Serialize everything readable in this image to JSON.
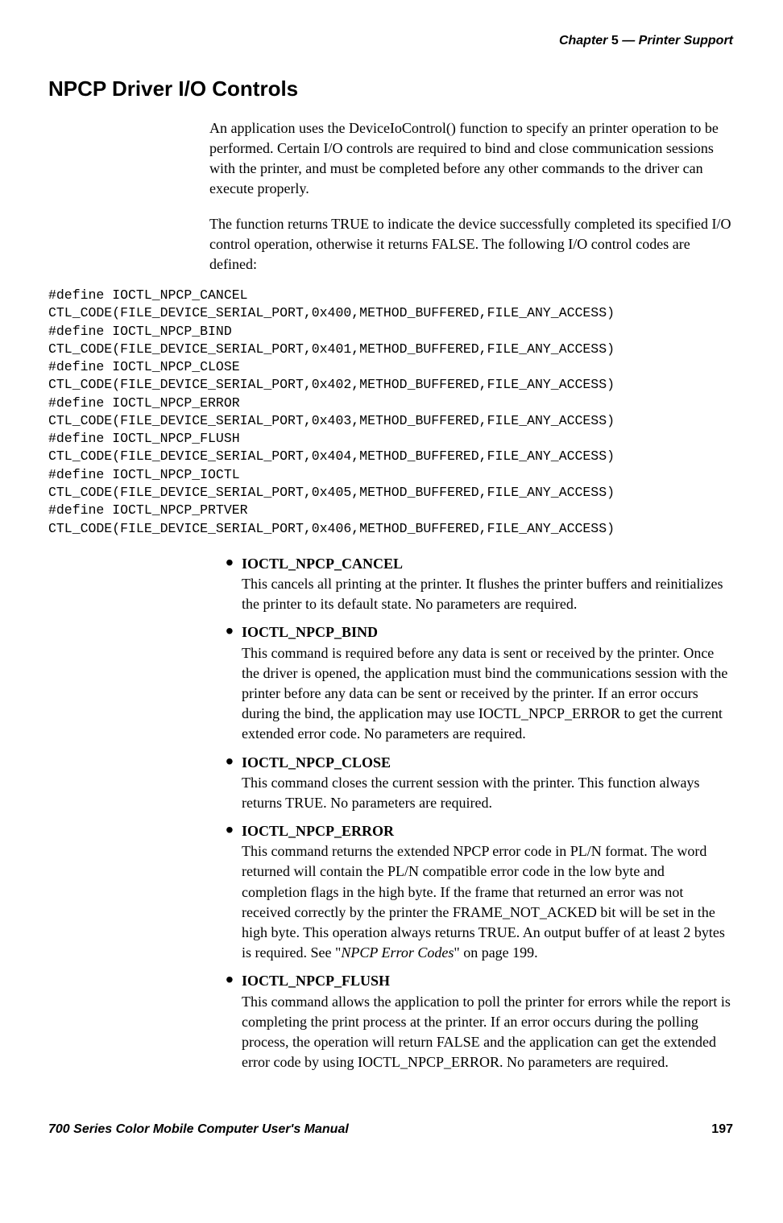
{
  "header": {
    "chapter_label": "Chapter",
    "chapter_num": "5",
    "separator": "—",
    "chapter_title": "Printer Support"
  },
  "title": "NPCP Driver I/O Controls",
  "para1": "An application uses the DeviceIoControl() function to specify an printer operation to be performed. Certain I/O controls are required to bind and close communication sessions with the printer, and must be completed before any other commands to the driver can execute properly.",
  "para2": "The function returns TRUE to indicate the device successfully completed its specified I/O control operation, otherwise it returns FALSE. The following I/O control codes are defined:",
  "code": "#define IOCTL_NPCP_CANCEL\nCTL_CODE(FILE_DEVICE_SERIAL_PORT,0x400,METHOD_BUFFERED,FILE_ANY_ACCESS)\n#define IOCTL_NPCP_BIND\nCTL_CODE(FILE_DEVICE_SERIAL_PORT,0x401,METHOD_BUFFERED,FILE_ANY_ACCESS)\n#define IOCTL_NPCP_CLOSE\nCTL_CODE(FILE_DEVICE_SERIAL_PORT,0x402,METHOD_BUFFERED,FILE_ANY_ACCESS)\n#define IOCTL_NPCP_ERROR\nCTL_CODE(FILE_DEVICE_SERIAL_PORT,0x403,METHOD_BUFFERED,FILE_ANY_ACCESS)\n#define IOCTL_NPCP_FLUSH\nCTL_CODE(FILE_DEVICE_SERIAL_PORT,0x404,METHOD_BUFFERED,FILE_ANY_ACCESS)\n#define IOCTL_NPCP_IOCTL\nCTL_CODE(FILE_DEVICE_SERIAL_PORT,0x405,METHOD_BUFFERED,FILE_ANY_ACCESS)\n#define IOCTL_NPCP_PRTVER\nCTL_CODE(FILE_DEVICE_SERIAL_PORT,0x406,METHOD_BUFFERED,FILE_ANY_ACCESS)",
  "items": [
    {
      "title": "IOCTL_NPCP_CANCEL",
      "desc": "This cancels all printing at the printer. It flushes the printer buffers and reinitializes the printer to its default state. No parameters are required."
    },
    {
      "title": "IOCTL_NPCP_BIND",
      "desc": "This command is required before any data is sent or received by the printer. Once the driver is opened, the application must bind the communications session with the printer before any data can be sent or received by the printer. If an error occurs during the bind, the application may use IOCTL_NPCP_ERROR to get the current extended error code. No parameters are required."
    },
    {
      "title": "IOCTL_NPCP_CLOSE",
      "desc": "This command closes the current session with the printer. This function always returns TRUE. No parameters are required."
    },
    {
      "title": "IOCTL_NPCP_ERROR",
      "desc_pre": "This command returns the extended NPCP error code in PL/N format. The word returned will contain the PL/N compatible error code in the low byte and completion flags in the high byte. If the frame that returned an error was not received correctly by the printer the FRAME_NOT_ACKED bit will be set in the high byte. This operation always returns TRUE. An output buffer of at least 2 bytes is required. See \"",
      "desc_italic": "NPCP Error Codes",
      "desc_post": "\" on page 199."
    },
    {
      "title": "IOCTL_NPCP_FLUSH",
      "desc": "This command allows the application to poll the printer for errors while the report is completing the print process at the printer. If an error occurs during the polling process, the operation will return FALSE and the application can get the extended error code by using IOCTL_NPCP_ERROR. No parameters are required."
    }
  ],
  "footer": {
    "left": "700 Series Color Mobile Computer User's Manual",
    "right": "197"
  }
}
